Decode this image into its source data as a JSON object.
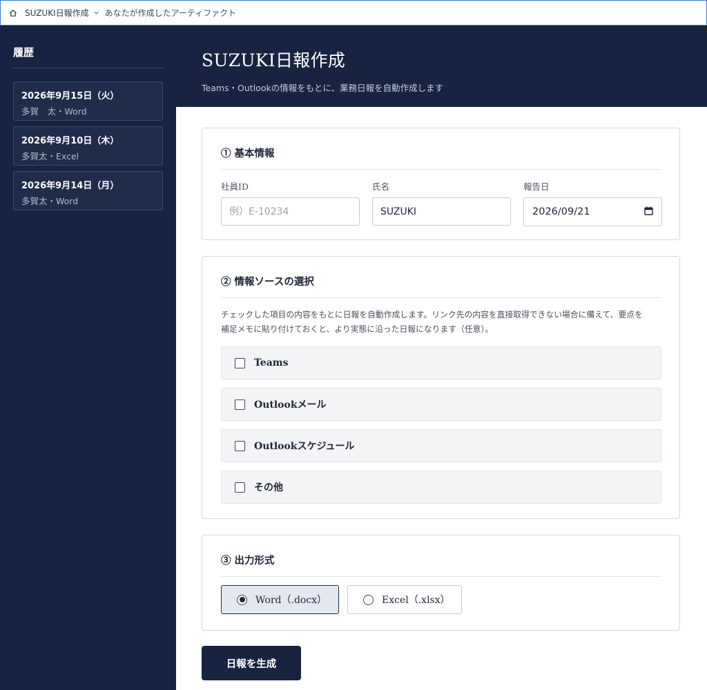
{
  "topbar": {
    "home_icon": "home-icon",
    "title": "SUZUKI日報作成",
    "subtitle": "あなたが作成したアーティファクト"
  },
  "sidebar": {
    "heading": "履歴",
    "items": [
      {
        "date": "2026年9月15日（火）",
        "sub": "多賀　太・Word"
      },
      {
        "date": "2026年9月10日（木）",
        "sub": "多賀太・Excel"
      },
      {
        "date": "2026年9月14日（月）",
        "sub": "多賀太・Word"
      }
    ]
  },
  "header": {
    "title": "SUZUKI日報作成",
    "subtitle": "Teams・Outlookの情報をもとに、業務日報を自動作成します"
  },
  "basic": {
    "title": "① 基本情報",
    "employee_id_label": "社員ID",
    "employee_id_placeholder": "例）E-10234",
    "employee_id_value": "",
    "name_label": "氏名",
    "name_value": "SUZUKI",
    "date_label": "報告日",
    "date_value": "2026/09/21",
    "calendar_icon": "calendar-icon"
  },
  "sources": {
    "title": "② 情報ソースの選択",
    "desc_line1": "チェックした項目の内容をもとに日報を自動作成します。リンク先の内容を直接取得できない場合に備えて、要点を",
    "desc_line2": "補足メモに貼り付けておくと、より実態に沿った日報になります（任意）。",
    "options": [
      {
        "label": "Teams",
        "checked": false
      },
      {
        "label": "Outlookメール",
        "checked": false
      },
      {
        "label": "Outlookスケジュール",
        "checked": false
      },
      {
        "label": "その他",
        "checked": false
      }
    ]
  },
  "output": {
    "title": "③ 出力形式",
    "options": [
      {
        "label": "Word（.docx）",
        "selected": true
      },
      {
        "label": "Excel（.xlsx）",
        "selected": false
      }
    ]
  },
  "generate_label": "日報を生成",
  "colors": {
    "navy": "#172340",
    "card_border": "#d4d7dd",
    "checkbox_bg": "#f3f4f6",
    "selected_bg": "#e4e8f0"
  }
}
